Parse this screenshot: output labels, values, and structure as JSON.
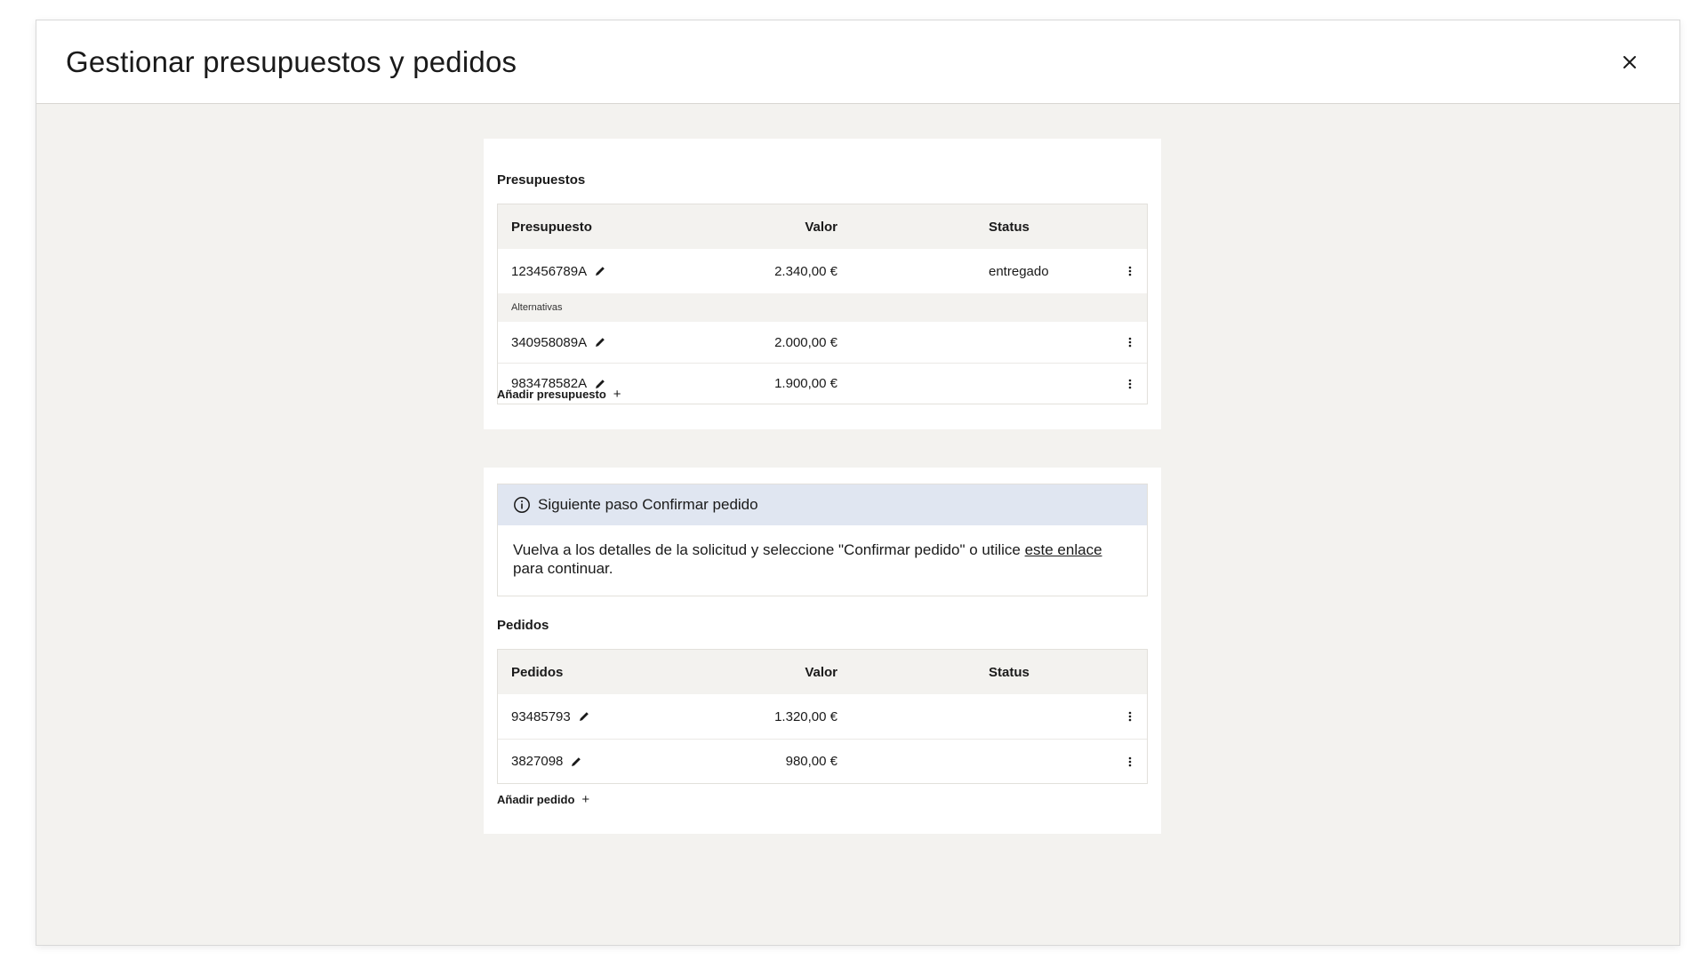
{
  "modal": {
    "title": "Gestionar presupuestos y pedidos",
    "close_icon": "close-icon"
  },
  "quotes": {
    "section_title": "Presupuestos",
    "columns": {
      "id": "Presupuesto",
      "value": "Valor",
      "status": "Status"
    },
    "main_row": {
      "id": "123456789A",
      "value": "2.340,00 €",
      "status": "entregado"
    },
    "alternatives_label": "Alternativas",
    "alternatives": [
      {
        "id": "340958089A",
        "value": "2.000,00 €",
        "status": ""
      },
      {
        "id": "983478582A",
        "value": "1.900,00 €",
        "status": ""
      }
    ],
    "add_label": "Añadir presupuesto",
    "add_icon": "+"
  },
  "info": {
    "title": "Siguiente paso Confirmar pedido",
    "text_before": "Vuelva a los detalles de la solicitud y seleccione \"Confirmar pedido\" o utilice ",
    "link_text": "este enlace",
    "text_after": " para continuar."
  },
  "orders": {
    "section_title": "Pedidos",
    "columns": {
      "id": "Pedidos",
      "value": "Valor",
      "status": "Status"
    },
    "rows": [
      {
        "id": "93485793",
        "value": "1.320,00 €",
        "status": ""
      },
      {
        "id": "3827098",
        "value": "980,00 €",
        "status": ""
      }
    ],
    "add_label": "Añadir pedido",
    "add_icon": "+"
  },
  "colors": {
    "background": "#f3f2ef",
    "card": "#ffffff",
    "info_banner": "#e0e6f1",
    "text": "#1a1a1a"
  }
}
